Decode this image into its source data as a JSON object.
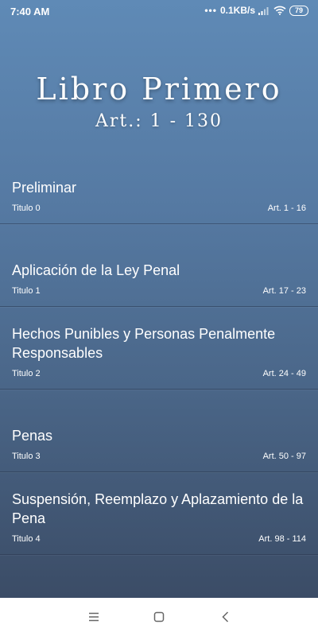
{
  "status_bar": {
    "time": "7:40 AM",
    "network_speed": "0.1KB/s",
    "battery": "79",
    "icons": [
      "more-dots-icon",
      "signal-icon",
      "wifi-icon",
      "battery-icon"
    ]
  },
  "header": {
    "title": "Libro Primero",
    "subtitle": "Art.: 1 - 130"
  },
  "titles": [
    {
      "name": "Preliminar",
      "titulo": "Titulo 0",
      "range": "Art. 1 - 16"
    },
    {
      "name": "Aplicación de la Ley Penal",
      "titulo": "Titulo 1",
      "range": "Art. 17 - 23"
    },
    {
      "name": "Hechos Punibles y Personas Penalmente Responsables",
      "titulo": "Titulo 2",
      "range": "Art. 24 - 49"
    },
    {
      "name": "Penas",
      "titulo": "Titulo 3",
      "range": "Art. 50 - 97"
    },
    {
      "name": "Suspensión, Reemplazo y Aplazamiento de la Pena",
      "titulo": "Titulo 4",
      "range": "Art. 98 - 114"
    }
  ],
  "nav_bar": {
    "buttons": [
      "menu-icon",
      "home-square-icon",
      "back-chevron-icon"
    ]
  },
  "colors": {
    "gradient_top": "#5f8ab6",
    "gradient_bottom": "#3b4c66",
    "text": "#ffffff",
    "nav_icon": "#666666"
  }
}
